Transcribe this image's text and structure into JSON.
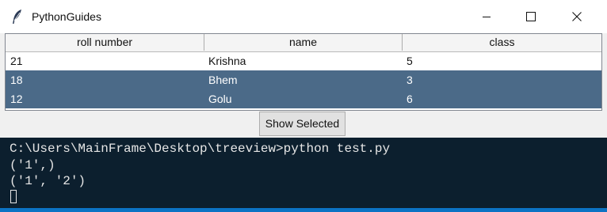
{
  "window": {
    "title": "PythonGuides",
    "app_icon": "feather-icon",
    "controls": {
      "minimize_icon": "minimize-icon",
      "maximize_icon": "maximize-icon",
      "close_icon": "close-icon"
    }
  },
  "treeview": {
    "columns": [
      "roll number",
      "name",
      "class"
    ],
    "rows": [
      {
        "roll": "21",
        "name": "Krishna",
        "class": "5",
        "selected": false
      },
      {
        "roll": "18",
        "name": "Bhem",
        "class": "3",
        "selected": true
      },
      {
        "roll": "12",
        "name": "Golu",
        "class": "6",
        "selected": true
      }
    ],
    "selection_color": "#4b6a88"
  },
  "button": {
    "label": "Show Selected"
  },
  "console": {
    "lines": [
      "C:\\Users\\MainFrame\\Desktop\\treeview>python test.py",
      "('1',)",
      "('1', '2')"
    ],
    "background": "#0c1f2e",
    "accent": "#0c73c4"
  }
}
